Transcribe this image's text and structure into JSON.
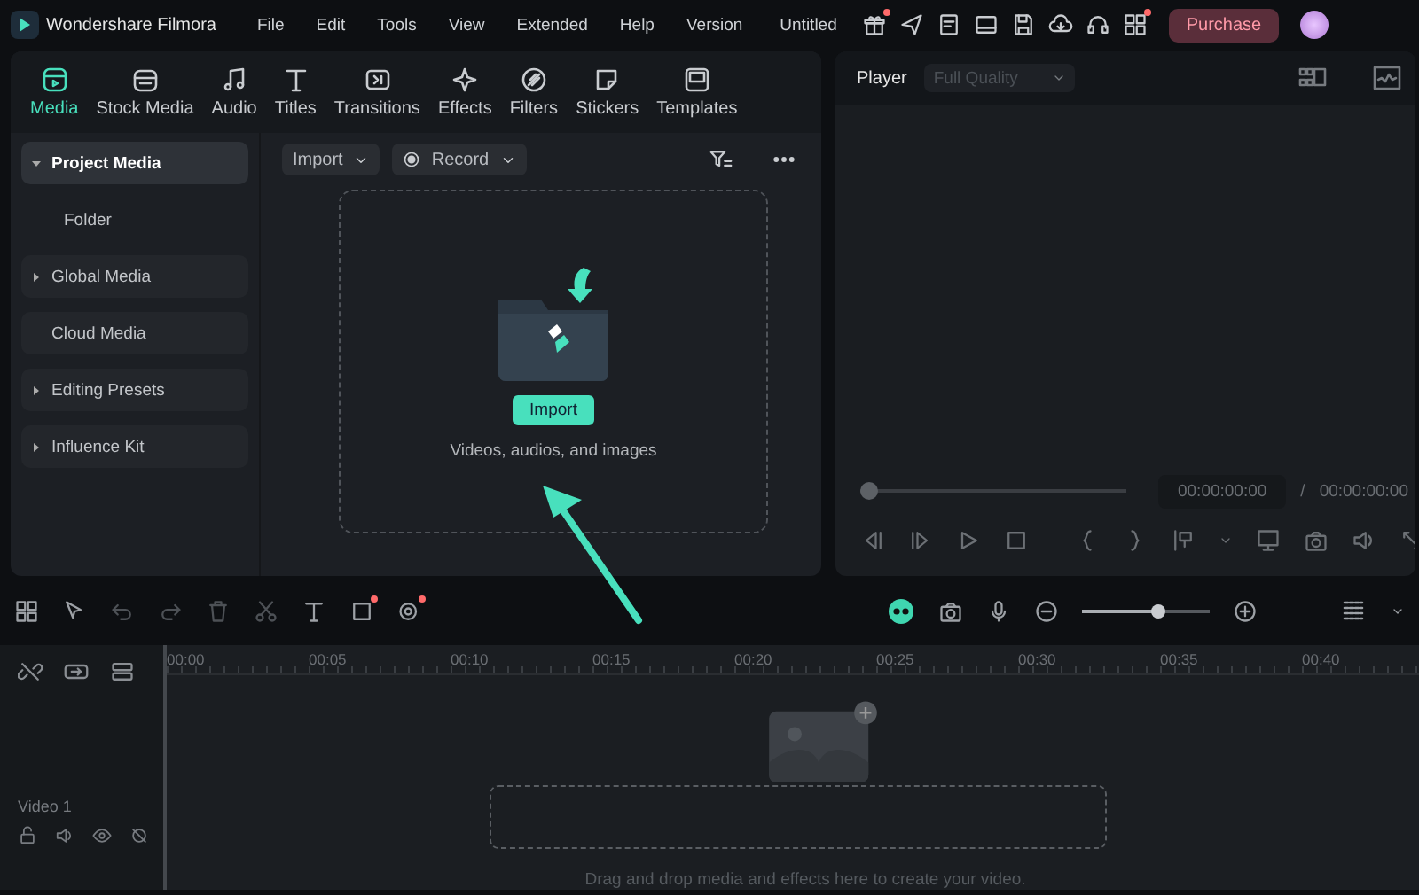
{
  "app": {
    "title": "Wondershare Filmora",
    "project_title": "Untitled",
    "purchase": "Purchase"
  },
  "menu": [
    "File",
    "Edit",
    "Tools",
    "View",
    "Extended",
    "Help",
    "Version"
  ],
  "tabs": [
    {
      "label": "Media",
      "selected": true
    },
    {
      "label": "Stock Media",
      "selected": false
    },
    {
      "label": "Audio",
      "selected": false
    },
    {
      "label": "Titles",
      "selected": false
    },
    {
      "label": "Transitions",
      "selected": false
    },
    {
      "label": "Effects",
      "selected": false
    },
    {
      "label": "Filters",
      "selected": false
    },
    {
      "label": "Stickers",
      "selected": false
    },
    {
      "label": "Templates",
      "selected": false
    }
  ],
  "sidebar": [
    {
      "label": "Project Media",
      "kind": "expanded",
      "selected": true
    },
    {
      "label": "Folder",
      "kind": "child",
      "selected": false
    },
    {
      "label": "Global Media",
      "kind": "collapsed",
      "selected": false
    },
    {
      "label": "Cloud Media",
      "kind": "leaf",
      "selected": false
    },
    {
      "label": "Editing Presets",
      "kind": "collapsed",
      "selected": false
    },
    {
      "label": "Influence Kit",
      "kind": "collapsed",
      "selected": false
    }
  ],
  "media_toolbar": {
    "import": "Import",
    "record": "Record"
  },
  "drop_zone": {
    "button": "Import",
    "hint": "Videos, audios, and images"
  },
  "player": {
    "title": "Player",
    "quality": "Full Quality",
    "quality_disabled": true,
    "progress": {
      "level": 0
    },
    "timecode": "00:00:00:00",
    "separator": "/",
    "duration": "00:00:00:00"
  },
  "timeline": {
    "zoom": {
      "level": 0.6
    },
    "ruler": [
      "00:00",
      "00:05",
      "00:10",
      "00:15",
      "00:20",
      "00:25",
      "00:30",
      "00:35",
      "00:40"
    ],
    "track": "Video 1",
    "hint": "Drag and drop media and effects here to create your video."
  }
}
